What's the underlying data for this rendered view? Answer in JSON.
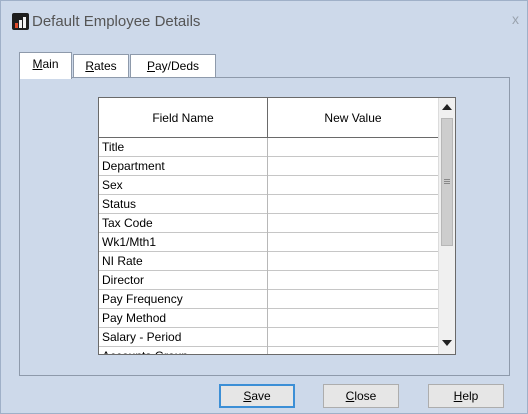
{
  "window": {
    "title": "Default Employee Details",
    "close_glyph": "x",
    "icon": "payroll-app-icon"
  },
  "tabs": [
    {
      "key": "M",
      "rest": "ain",
      "active": true
    },
    {
      "key": "R",
      "rest": "ates",
      "active": false
    },
    {
      "key": "P",
      "rest": "ay/Deds",
      "active": false
    }
  ],
  "grid": {
    "headers": [
      "Field Name",
      "New Value"
    ],
    "rows": [
      {
        "field": "Title",
        "value": ""
      },
      {
        "field": "Department",
        "value": ""
      },
      {
        "field": "Sex",
        "value": ""
      },
      {
        "field": "Status",
        "value": ""
      },
      {
        "field": "Tax Code",
        "value": ""
      },
      {
        "field": "Wk1/Mth1",
        "value": ""
      },
      {
        "field": "NI Rate",
        "value": ""
      },
      {
        "field": "Director",
        "value": ""
      },
      {
        "field": "Pay Frequency",
        "value": ""
      },
      {
        "field": "Pay Method",
        "value": ""
      },
      {
        "field": "Salary - Period",
        "value": ""
      },
      {
        "field": "Accounts Group",
        "value": ""
      }
    ]
  },
  "buttons": {
    "save": {
      "key": "S",
      "rest": "ave"
    },
    "close": {
      "key": "C",
      "rest": "lose"
    },
    "help": {
      "key": "H",
      "rest": "elp"
    }
  },
  "colors": {
    "background": "#cdd9ea",
    "focus_border": "#3c8fd6"
  }
}
